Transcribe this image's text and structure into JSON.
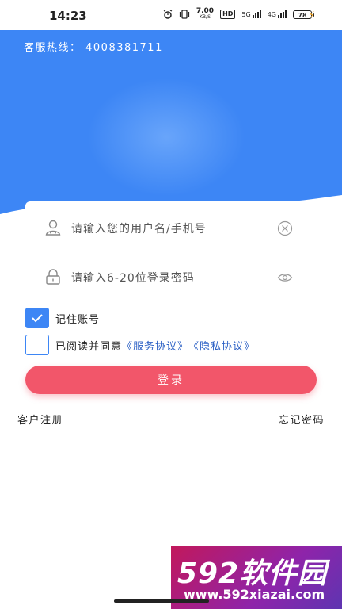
{
  "status_bar": {
    "time": "14:23",
    "net_speed_value": "7.00",
    "net_speed_unit": "KB/S",
    "hd_badge": "HD",
    "sig1_label": "5G",
    "sig2_label": "4G",
    "battery": "78"
  },
  "header": {
    "hotline": "客服热线： 4008381711"
  },
  "form": {
    "username_placeholder": "请输入您的用户名/手机号",
    "password_placeholder": "请输入6-20位登录密码"
  },
  "options": {
    "remember_label": "记住账号",
    "remember_checked": true,
    "agree_prefix": "已阅读并同意",
    "service_agreement": "《服务协议》",
    "privacy_agreement": "《隐私协议》",
    "agree_checked": false
  },
  "actions": {
    "login_label": "登录",
    "register_label": "客户注册",
    "forgot_label": "忘记密码"
  },
  "watermark": {
    "title": "592软件园",
    "url": "www.592xiazai.com"
  },
  "colors": {
    "primary_blue": "#3d86f5",
    "login_button": "#f2566a",
    "link_blue": "#2f63c6"
  }
}
